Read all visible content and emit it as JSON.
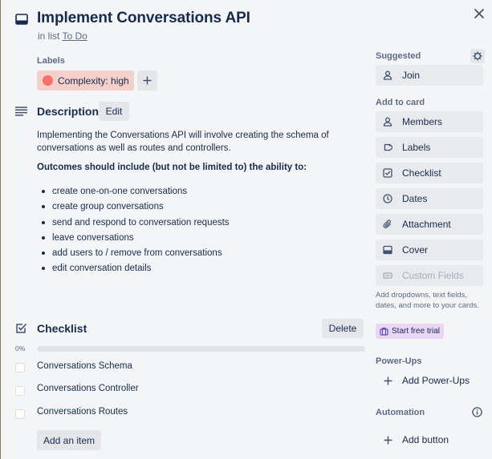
{
  "card": {
    "title": "Implement Conversations API",
    "list_prefix": "in list",
    "list_name": "To Do"
  },
  "labels": {
    "heading": "Labels",
    "items": [
      {
        "text": "Complexity: high",
        "color": "#f87168",
        "bg": "#f5cfca"
      }
    ]
  },
  "description": {
    "title": "Description",
    "edit_label": "Edit",
    "paragraph": "Implementing the Conversations API will involve creating the schema of conversations as well as routes and controllers.",
    "outcomes_heading": "Outcomes should include (but not be limited to) the ability to:",
    "bullets": [
      "create one-on-one conversations",
      "create group conversations",
      "send and respond to conversation requests",
      "leave conversations",
      "add users to / remove from conversations",
      "edit conversation details"
    ]
  },
  "checklist": {
    "title": "Checklist",
    "delete_label": "Delete",
    "progress_text": "0%",
    "progress": 0,
    "items": [
      {
        "text": "Conversations Schema",
        "checked": false
      },
      {
        "text": "Conversations Controller",
        "checked": false
      },
      {
        "text": "Conversations Routes",
        "checked": false
      }
    ],
    "add_item_label": "Add an item"
  },
  "sidebar": {
    "suggested_heading": "Suggested",
    "join_label": "Join",
    "add_to_card_heading": "Add to card",
    "add_to_card": [
      {
        "label": "Members",
        "icon": "person-icon"
      },
      {
        "label": "Labels",
        "icon": "tag-icon"
      },
      {
        "label": "Checklist",
        "icon": "checklist-icon"
      },
      {
        "label": "Dates",
        "icon": "clock-icon"
      },
      {
        "label": "Attachment",
        "icon": "paperclip-icon"
      },
      {
        "label": "Cover",
        "icon": "cover-icon"
      }
    ],
    "custom_fields_label": "Custom Fields",
    "custom_fields_note": "Add dropdowns, text fields, dates, and more to your cards.",
    "trial_label": "Start free trial",
    "powerups_heading": "Power-Ups",
    "add_powerups_label": "Add Power-Ups",
    "automation_heading": "Automation",
    "add_button_label": "Add button"
  },
  "colors": {
    "accent_text": "#172b4d",
    "muted_text": "#5e6c84",
    "button_bg": "#e4e6ea",
    "trial_bg": "#e9d6f5",
    "progress_fill": "#61bd4f"
  }
}
